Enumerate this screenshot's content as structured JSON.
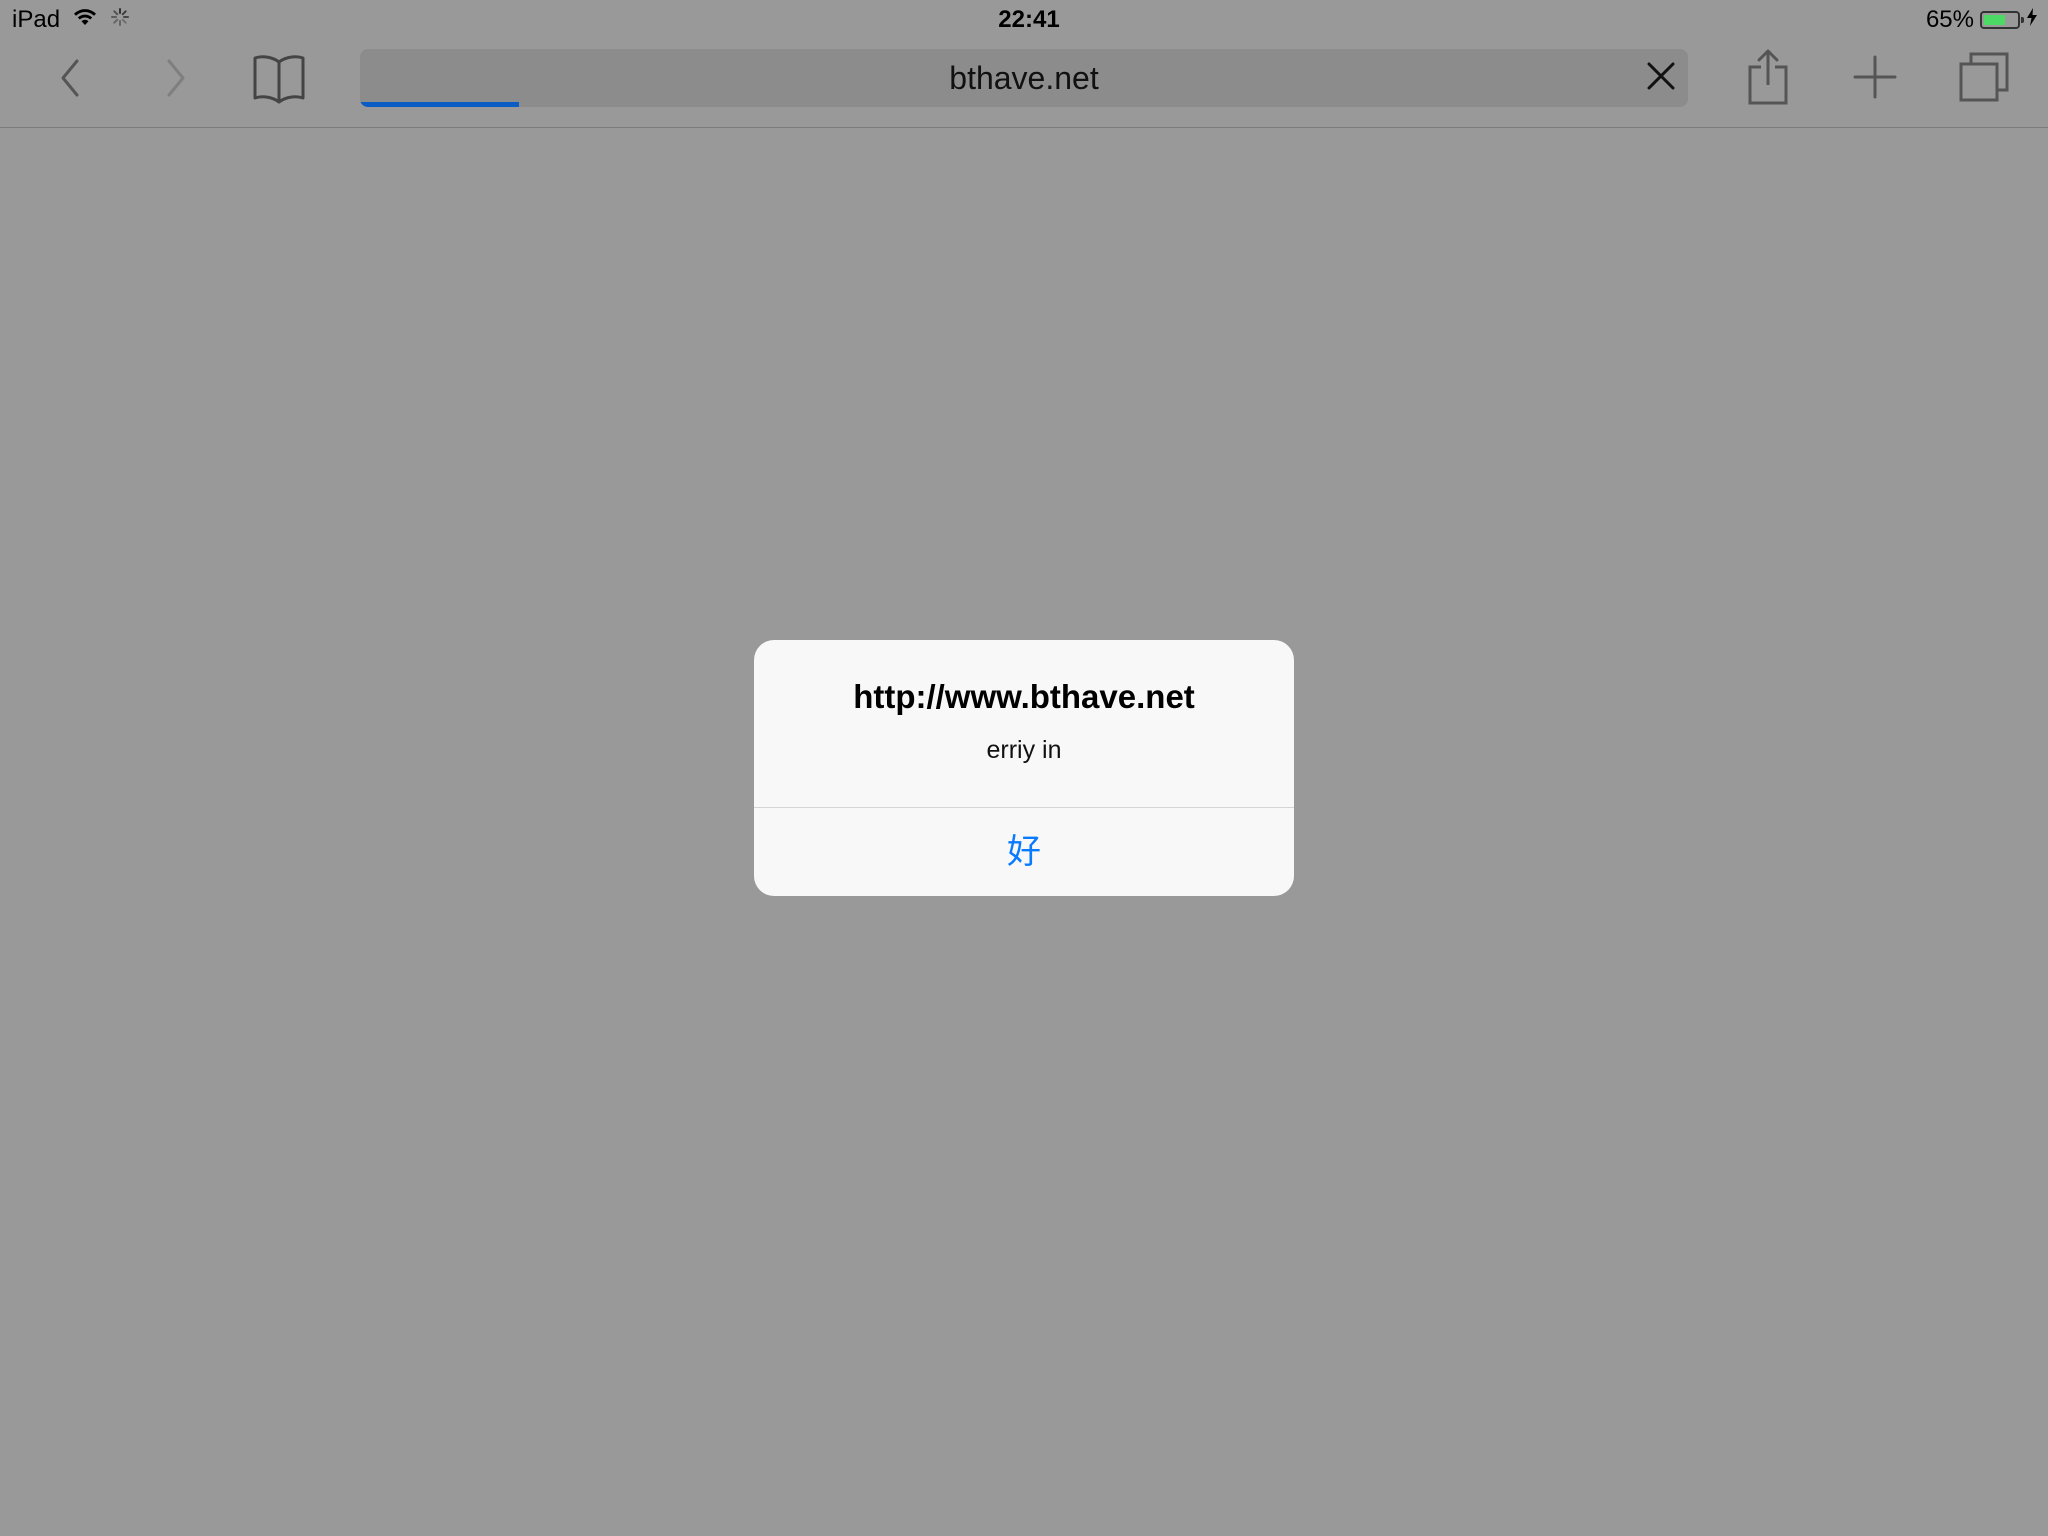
{
  "status_bar": {
    "device": "iPad",
    "time": "22:41",
    "battery_percent": "65%",
    "battery_level": 0.65,
    "icons": [
      "wifi-icon",
      "activity-spinner-icon",
      "battery-icon",
      "charging-bolt-icon"
    ]
  },
  "toolbar": {
    "url": "bthave.net",
    "load_progress": 0.12,
    "icons": [
      "back-chevron-icon",
      "forward-chevron-icon",
      "bookmarks-book-icon",
      "clear-x-icon",
      "share-icon",
      "plus-icon",
      "tabs-icon"
    ]
  },
  "alert": {
    "title": "http://www.bthave.net",
    "message": "erriy in",
    "ok_label": "好"
  },
  "colors": {
    "background": "#999999",
    "url_field": "#8c8c8c",
    "progress": "#0b5cc5",
    "alert_background": "#f8f8f8",
    "alert_button": "#0a7aff",
    "battery_fill": "#4cd964"
  }
}
